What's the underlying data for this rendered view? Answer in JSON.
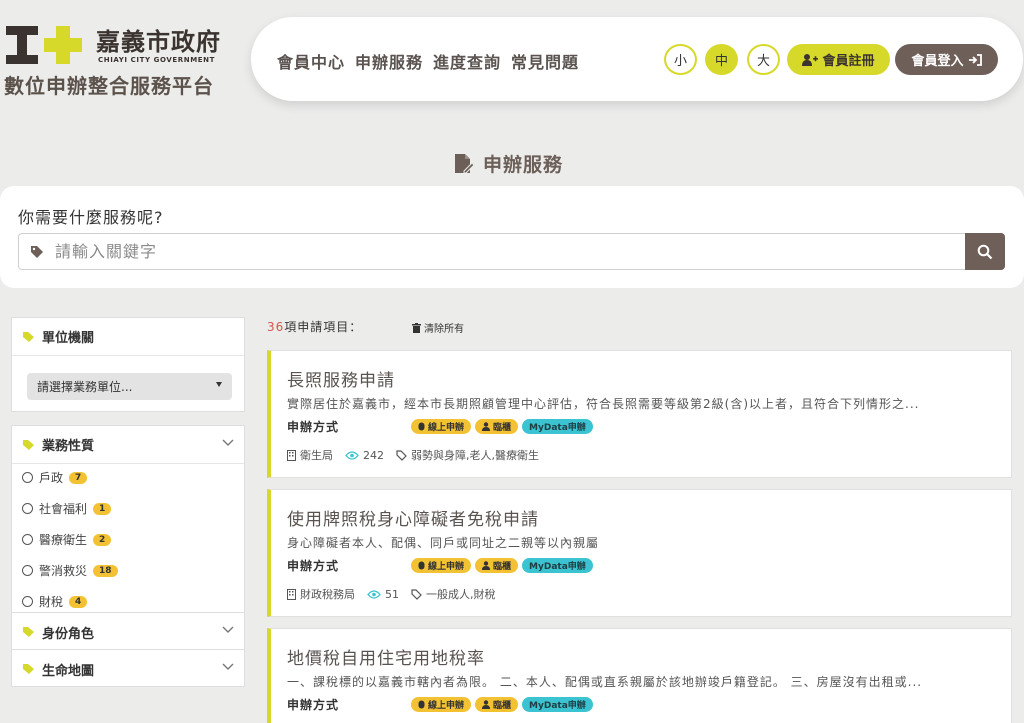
{
  "header": {
    "city_name": "嘉義市政府",
    "city_en": "CHIAYI CITY GOVERNMENT",
    "platform_name": "數位申辦整合服務平台",
    "nav_links": [
      "會員中心",
      "申辦服務",
      "進度查詢",
      "常見問題"
    ],
    "font_sizes": [
      "小",
      "中",
      "大"
    ],
    "register_label": "會員註冊",
    "login_label": "會員登入",
    "brand_colors": {
      "accent": "#d7d92a",
      "brown": "#6e5f58"
    }
  },
  "page": {
    "section_title": "申辦服務",
    "search_question": "你需要什麼服務呢?",
    "search_placeholder": "請輸入關鍵字"
  },
  "sidebar": {
    "unit_title": "單位機關",
    "unit_select": "請選擇業務單位...",
    "business_title": "業務性質",
    "business_items": [
      {
        "label": "戶政",
        "count": "7"
      },
      {
        "label": "社會福利",
        "count": "1"
      },
      {
        "label": "醫療衛生",
        "count": "2"
      },
      {
        "label": "警消救災",
        "count": "18"
      },
      {
        "label": "財稅",
        "count": "4"
      }
    ],
    "identity_title": "身份角色",
    "life_title": "生命地圖"
  },
  "results": {
    "count": "36",
    "count_suffix": "項申請項目：",
    "clear_all": "清除所有",
    "method_label": "申辦方式",
    "tag_online": "線上申辦",
    "tag_counter": "臨櫃",
    "tag_mydata": "MyData申辦",
    "cards": [
      {
        "title": "長照服務申請",
        "desc": "實際居住於嘉義市，經本市長期照顧管理中心評估，符合長照需要等級第2級(含)以上者，且符合下列情形之...",
        "agency": "衛生局",
        "views": "242",
        "tags": "弱勢與身障,老人,醫療衛生"
      },
      {
        "title": "使用牌照稅身心障礙者免稅申請",
        "desc": "身心障礙者本人、配偶、同戶或同址之二親等以內親屬",
        "agency": "財政稅務局",
        "views": "51",
        "tags": "一般成人,財稅"
      },
      {
        "title": "地價稅自用住宅用地稅率",
        "desc": "一、課稅標的以嘉義市轄內者為限。 二、本人、配偶或直系親屬於該地辦竣戶籍登記。 三、房屋沒有出租或...",
        "agency": "",
        "views": "",
        "tags": ""
      }
    ]
  }
}
